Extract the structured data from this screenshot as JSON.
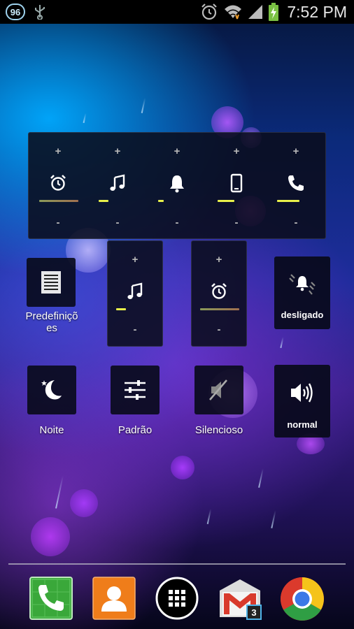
{
  "status_bar": {
    "battery_level": "96",
    "time": "7:52 PM",
    "icons": [
      "usb-icon",
      "alarm-icon",
      "wifi-icon",
      "signal-icon",
      "battery-charging-icon"
    ]
  },
  "volume_widget": {
    "plus": "+",
    "minus": "-",
    "channels": [
      {
        "name": "alarm",
        "icon": "alarm-clock-icon",
        "level": 0.95,
        "color": "#8a9a5a"
      },
      {
        "name": "music",
        "icon": "music-note-icon",
        "level": 0.25,
        "color": "#e8f04a"
      },
      {
        "name": "notification",
        "icon": "bell-icon",
        "level": 0.15,
        "color": "#e8f04a"
      },
      {
        "name": "system",
        "icon": "phone-device-icon",
        "level": 0.45,
        "color": "#e8f04a"
      },
      {
        "name": "call",
        "icon": "phone-handset-icon",
        "level": 0.6,
        "color": "#e8f04a"
      }
    ]
  },
  "music_widget": {
    "plus": "+",
    "minus": "-",
    "icon": "music-note-icon",
    "level": 0.25
  },
  "alarm_widget": {
    "plus": "+",
    "minus": "-",
    "icon": "alarm-clock-icon",
    "level": 0.95
  },
  "presets": {
    "label": "Predefiniçõ es",
    "icon": "list-document-icon"
  },
  "vibrate_toggle": {
    "label": "desligado",
    "icon": "vibrate-bell-icon"
  },
  "profiles": [
    {
      "label": "Noite",
      "icon": "moon-star-icon"
    },
    {
      "label": "Padrão",
      "icon": "sliders-icon"
    },
    {
      "label": "Silencioso",
      "icon": "speaker-muted-icon"
    }
  ],
  "ringer_toggle": {
    "label": "normal",
    "icon": "speaker-loud-icon"
  },
  "dock": {
    "apps": [
      "phone-app-icon",
      "contacts-app-icon",
      "app-drawer-icon",
      "gmail-app-icon",
      "chrome-app-icon"
    ],
    "gmail_badge": "3"
  }
}
